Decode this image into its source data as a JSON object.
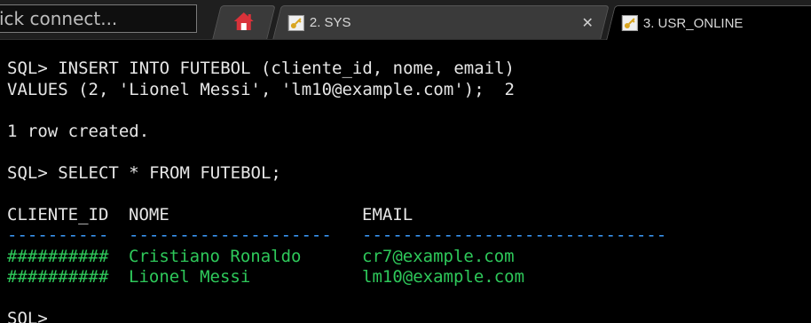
{
  "quick_connect": {
    "placeholder": "ick connect..."
  },
  "tabs": [
    {
      "label": "",
      "icon": "home-icon"
    },
    {
      "label": "2. SYS",
      "icon": "key-icon",
      "close": "✕"
    },
    {
      "label": "3. USR_ONLINE",
      "icon": "key-icon",
      "active": true
    }
  ],
  "terminal": {
    "lines": [
      "SQL> INSERT INTO FUTEBOL (cliente_id, nome, email)",
      "VALUES (2, 'Lionel Messi', 'lm10@example.com');  2",
      "",
      "1 row created.",
      "",
      "SQL> SELECT * FROM FUTEBOL;",
      ""
    ],
    "table": {
      "headers": [
        "CLIENTE_ID",
        "NOME",
        "EMAIL"
      ],
      "separators": [
        "----------",
        "--------------------",
        "------------------------------"
      ],
      "rows": [
        [
          "##########",
          "Cristiano Ronaldo",
          "cr7@example.com"
        ],
        [
          "##########",
          "Lionel Messi",
          "lm10@example.com"
        ]
      ]
    },
    "prompt": "SQL>"
  },
  "colors": {
    "background": "#000000",
    "text": "#e6e6e6",
    "green": "#2ec85a",
    "blue": "#3d9dff",
    "home_icon": "#d9323a"
  }
}
